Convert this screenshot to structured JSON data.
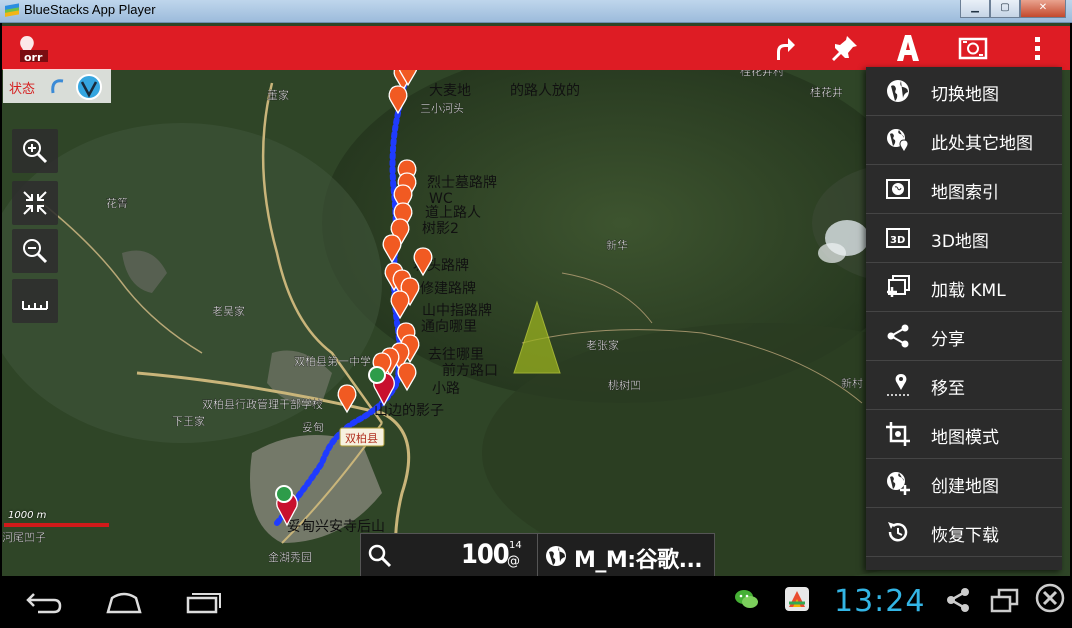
{
  "window": {
    "title": "BlueStacks App Player",
    "controls": [
      "minimize",
      "maximize",
      "close"
    ]
  },
  "appbar": {
    "color": "#de1c24",
    "logo_text": "orr",
    "actions": [
      "route-icon",
      "pin-icon",
      "text-style-icon",
      "map-layer-icon",
      "overflow-menu-icon"
    ]
  },
  "status": {
    "label": "状态"
  },
  "map_controls": [
    "zoom-in-icon",
    "fit-bounds-icon",
    "zoom-out-icon",
    "ruler-icon"
  ],
  "map": {
    "place_labels": [
      "董家",
      "桂花井村",
      "桂花井",
      "花箐",
      "老吴家",
      "双柏县第一中学",
      "新华",
      "老张家",
      "桃树凹",
      "新村",
      "双柏县行政管理干部学校",
      "下王家",
      "妥甸",
      "双柏县",
      "金湖秀园",
      "河尾凹子",
      "三小河头"
    ],
    "track_labels": [
      "大麦地",
      "烈士墓路牌",
      "WC",
      "道上路人",
      "树影2",
      "坡头路牌",
      "通向哪里",
      "山中指路牌",
      "去往哪里",
      "前方路口",
      "小路",
      "山边的影子",
      "妥甸兴安寺后山",
      "的路人放的",
      "修建路牌"
    ]
  },
  "scale": {
    "label": "1000 m"
  },
  "zoom": {
    "value": "100",
    "superscript": "14",
    "suffix": "@"
  },
  "map_source": {
    "text": "M_M:谷歌..."
  },
  "menu": {
    "items": [
      {
        "label": "切换地图",
        "icon": "globe-icon"
      },
      {
        "label": "此处其它地图",
        "icon": "globe-pin-icon"
      },
      {
        "label": "地图索引",
        "icon": "map-index-icon"
      },
      {
        "label": "3D地图",
        "icon": "3d-map-icon"
      },
      {
        "label": "加载 KML",
        "icon": "load-kml-icon"
      },
      {
        "label": "分享",
        "icon": "share-icon"
      },
      {
        "label": "移至",
        "icon": "move-to-icon"
      },
      {
        "label": "地图模式",
        "icon": "crop-icon"
      },
      {
        "label": "创建地图",
        "icon": "create-map-icon"
      },
      {
        "label": "恢复下载",
        "icon": "restore-download-icon"
      }
    ]
  },
  "navbar": {
    "time": "13:24",
    "buttons": [
      "back-icon",
      "home-icon",
      "recent-apps-icon"
    ],
    "right_icons": [
      "wechat-icon",
      "app-store-icon",
      "share-icon",
      "window-icon",
      "close-icon"
    ]
  }
}
